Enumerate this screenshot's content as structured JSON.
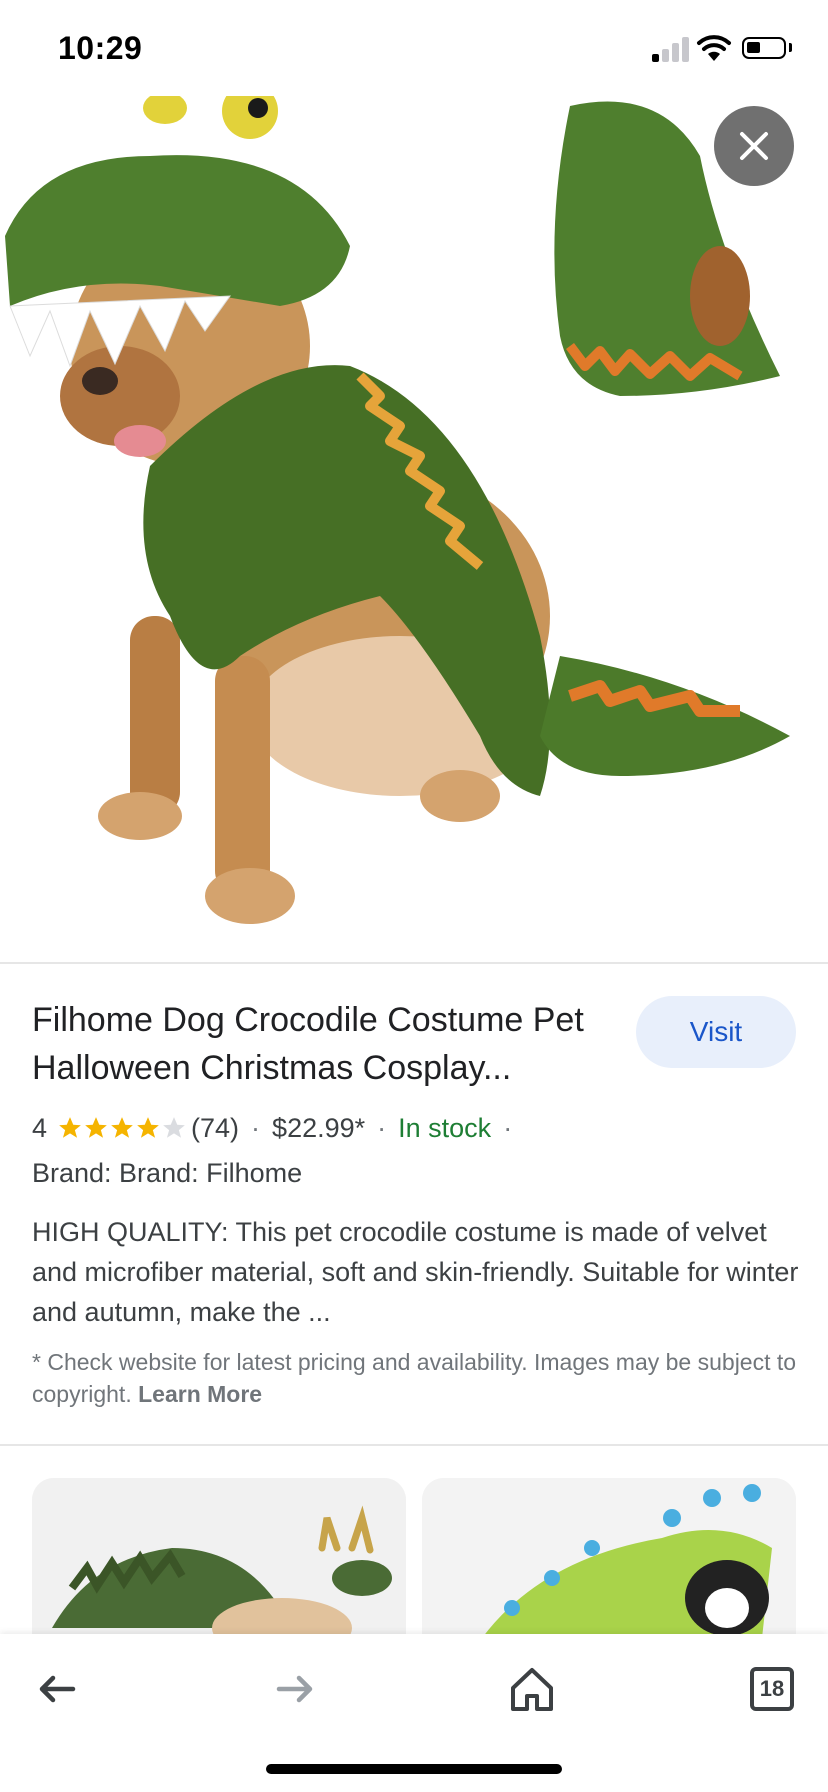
{
  "status_bar": {
    "time": "10:29"
  },
  "product": {
    "title": "Filhome Dog Crocodile Costume Pet Halloween Christmas Cosplay...",
    "visit_label": "Visit",
    "rating": "4",
    "rating_stars": 4,
    "review_count": "(74)",
    "price": "$22.99*",
    "availability": "In stock",
    "brand": "Brand: Brand: Filhome",
    "description": "HIGH QUALITY: This pet crocodile costume is made of velvet and microfiber material, soft and skin-friendly. Suitable for winter and autumn, make the ...",
    "disclaimer": "* Check website for latest pricing and availability. Images may be subject to copyright.",
    "learn_more": "Learn More"
  },
  "nav": {
    "tabs_count": "18"
  },
  "colors": {
    "accent": "#1a56c9",
    "visit_bg": "#e8effb",
    "star": "#f5b400",
    "in_stock": "#1e7e34",
    "costume_green": "#4a7a2c"
  },
  "icons": [
    "close-icon",
    "back-arrow-icon",
    "forward-arrow-icon",
    "home-icon",
    "tabs-icon",
    "wifi-icon",
    "battery-icon",
    "signal-icon",
    "star-icon"
  ]
}
